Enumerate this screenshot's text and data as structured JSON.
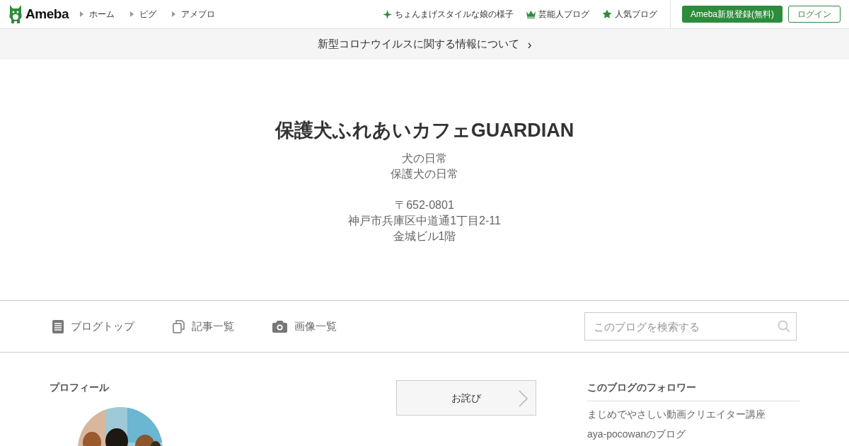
{
  "header": {
    "logo": "Ameba",
    "nav": [
      "ホーム",
      "ピグ",
      "アメブロ"
    ],
    "links": [
      {
        "kind": "sparkle",
        "label": "ちょんまげスタイルな娘の様子"
      },
      {
        "kind": "crown",
        "label": "芸能人ブログ"
      },
      {
        "kind": "star",
        "label": "人気ブログ"
      }
    ],
    "register_button": "Ameba新規登録(無料)",
    "login_button": "ログイン"
  },
  "banner": {
    "text": "新型コロナウイルスに関する情報について",
    "arrow": "›"
  },
  "blog": {
    "title": "保護犬ふれあいカフェGUARDIAN",
    "description_blocks": [
      [
        "犬の日常",
        "保護犬の日常"
      ],
      [
        "〒652-0801",
        "神戸市兵庫区中道通1丁目2-11",
        "金城ビル1階"
      ]
    ]
  },
  "blog_nav": [
    {
      "kind": "document",
      "label": "ブログトップ"
    },
    {
      "kind": "pages",
      "label": "記事一覧"
    },
    {
      "kind": "camera",
      "label": "画像一覧"
    }
  ],
  "search": {
    "placeholder": "このブログを検索する"
  },
  "profile": {
    "heading": "プロフィール"
  },
  "apology_button": "お詫び",
  "followers": {
    "heading": "このブログのフォロワー",
    "items": [
      "まじめでやさしい動画クリエイター講座",
      "aya-pocowanのブログ"
    ]
  }
}
